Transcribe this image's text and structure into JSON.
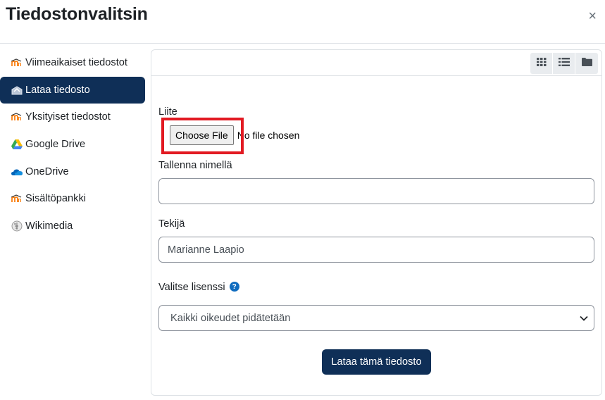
{
  "dialog": {
    "title": "Tiedostonvalitsin",
    "close_label": "×"
  },
  "sidebar": {
    "items": [
      {
        "label": "Viimeaikaiset tiedostot",
        "icon": "moodle-icon"
      },
      {
        "label": "Lataa tiedosto",
        "icon": "upload-icon",
        "active": true
      },
      {
        "label": "Yksityiset tiedostot",
        "icon": "moodle-icon"
      },
      {
        "label": "Google Drive",
        "icon": "google-drive-icon"
      },
      {
        "label": "OneDrive",
        "icon": "onedrive-icon"
      },
      {
        "label": "Sisältöpankki",
        "icon": "moodle-icon"
      },
      {
        "label": "Wikimedia",
        "icon": "wikimedia-icon"
      }
    ]
  },
  "toolbar": {
    "icons": [
      "grid-view-icon",
      "list-view-icon",
      "folder-view-icon"
    ]
  },
  "form": {
    "attachment_label": "Liite",
    "choose_file_label": "Choose File",
    "no_file_text": "No file chosen",
    "save_as_label": "Tallenna nimellä",
    "save_as_value": "",
    "author_label": "Tekijä",
    "author_value": "Marianne Laapio",
    "license_label": "Valitse lisenssi",
    "license_help": "?",
    "license_value": "Kaikki oikeudet pidätetään",
    "submit_label": "Lataa tämä tiedosto"
  },
  "colors": {
    "primary": "#0f2f57",
    "highlight": "#e21a22",
    "help": "#0f6cbf"
  }
}
